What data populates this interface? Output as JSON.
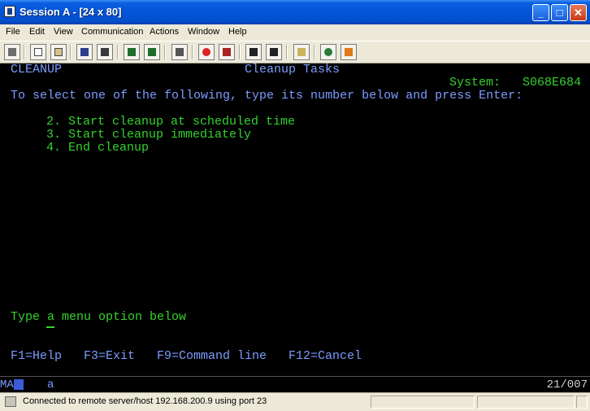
{
  "window": {
    "title": "Session A - [24 x 80]",
    "buttons": {
      "minimize": "_",
      "maximize": "□",
      "close": "✕"
    }
  },
  "menu": [
    "File",
    "Edit",
    "View",
    "Communication",
    "Actions",
    "Window",
    "Help"
  ],
  "toolbar": {
    "icons": [
      "print-screen-icon",
      "copy-icon",
      "paste-icon",
      "send-icon",
      "receive-icon",
      "display-icon",
      "config-icon",
      "keyboard-icon",
      "record-macro-icon",
      "stop-macro-icon",
      "play-macro-icon",
      "step-macro-icon",
      "clipboard-icon",
      "globe-icon",
      "help-ticket-icon"
    ]
  },
  "screen": {
    "menu_name": "CLEANUP",
    "title": "Cleanup Tasks",
    "system_label": "System:",
    "system_name": "S068E684",
    "instruction": "To select one of the following, type its number below and press Enter:",
    "options": [
      "2. Start cleanup at scheduled time",
      "3. Start cleanup immediately",
      "4. End cleanup"
    ],
    "prompt": "Type a menu option below",
    "function_keys": [
      "F1=Help",
      "F3=Exit",
      "F9=Command line",
      "F12=Cancel"
    ]
  },
  "oia": {
    "mode": "MA",
    "indicator": "a",
    "cursor_position": "21/007"
  },
  "status": {
    "message": "Connected to remote server/host 192.168.200.9 using port 23"
  },
  "colors": {
    "green": "#35d22e",
    "blue": "#7c9cff",
    "background": "#000000"
  }
}
